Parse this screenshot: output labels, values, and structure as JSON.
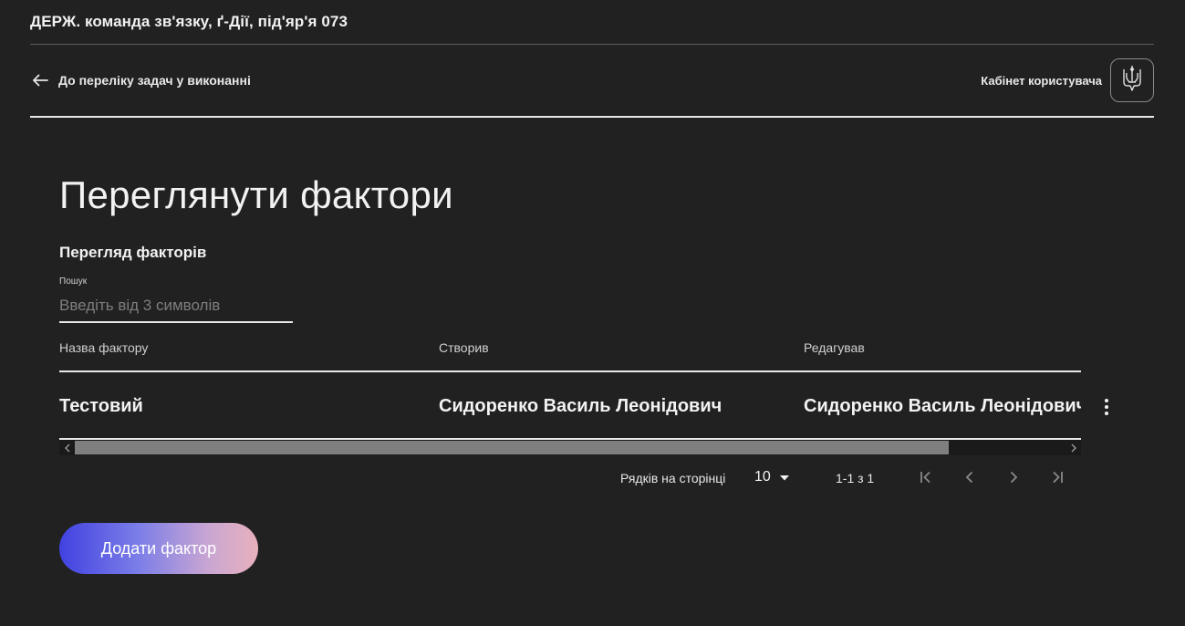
{
  "header": {
    "org_title": "ДЕРЖ. команда зв'язку, ґ-Дії, під'яр'я 073"
  },
  "nav": {
    "back_label": "До переліку задач у виконанні",
    "cabinet_label": "Кабінет користувача",
    "avatar_icon": "trident-icon"
  },
  "main": {
    "title": "Переглянути фактори",
    "section_title": "Перегляд факторів",
    "search": {
      "label": "Пошук",
      "placeholder": "Введіть від 3 символів",
      "value": ""
    },
    "table": {
      "headers": [
        "Назва фактору",
        "Створив",
        "Редагував"
      ],
      "rows": [
        [
          "Тестовий",
          "Сидоренко Василь Леонідович",
          "Сидоренко Василь Леонідович"
        ]
      ]
    },
    "pagination": {
      "rows_per_page_label": "Рядків на сторінці",
      "rows_per_page_value": "10",
      "range_text": "1-1 з 1"
    },
    "add_button_label": "Додати фактор"
  },
  "colors": {
    "background": "#212121",
    "text": "#f2f2f2",
    "button_gradient_start": "#4142e0",
    "button_gradient_end": "#e8b1bc"
  }
}
